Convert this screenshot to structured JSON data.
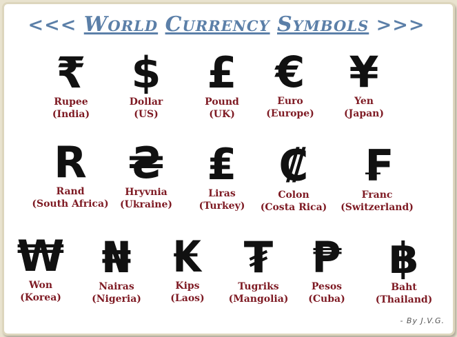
{
  "title": {
    "prefix": "<<<",
    "word1": "World",
    "word2": "Currency",
    "word3": "Symbols",
    "suffix": ">>>"
  },
  "currencies": [
    {
      "symbol": "₹",
      "name": "Rupee",
      "country": "(India)"
    },
    {
      "symbol": "$",
      "name": "Dollar",
      "country": "(US)"
    },
    {
      "symbol": "£",
      "name": "Pound",
      "country": "(UK)"
    },
    {
      "symbol": "€",
      "name": "Euro",
      "country": "(Europe)"
    },
    {
      "symbol": "¥",
      "name": "Yen",
      "country": "(Japan)"
    },
    {
      "symbol": "R",
      "name": "Rand",
      "country": "(South Africa)"
    },
    {
      "symbol": "₴",
      "name": "Hryvnia",
      "country": "(Ukraine)"
    },
    {
      "symbol": "₤",
      "name": "Liras",
      "country": "(Turkey)"
    },
    {
      "symbol": "₡",
      "name": "Colon",
      "country": "(Costa Rica)"
    },
    {
      "symbol": "₣",
      "name": "Franc",
      "country": "(Switzerland)"
    },
    {
      "symbol": "₩",
      "name": "Won",
      "country": "(Korea)"
    },
    {
      "symbol": "₦",
      "name": "Nairas",
      "country": "(Nigeria)"
    },
    {
      "symbol": "₭",
      "name": "Kips",
      "country": "(Laos)"
    },
    {
      "symbol": "₮",
      "name": "Tugriks",
      "country": "(Mangolia)"
    },
    {
      "symbol": "₱",
      "name": "Pesos",
      "country": "(Cuba)"
    },
    {
      "symbol": "฿",
      "name": "Baht",
      "country": "(Thailand)"
    }
  ],
  "credit": "- By J.V.G."
}
